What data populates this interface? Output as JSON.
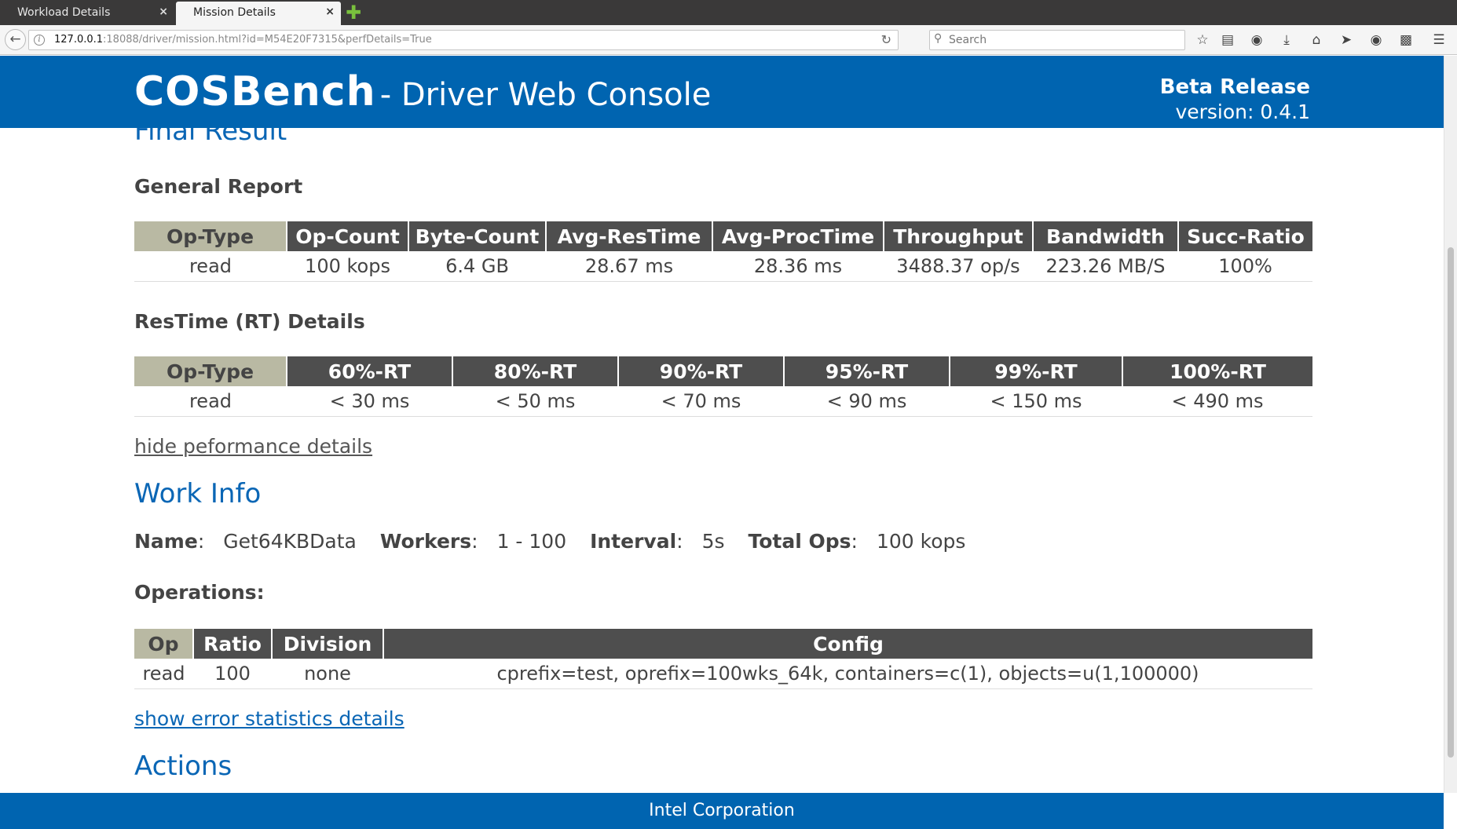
{
  "browser": {
    "tabs": [
      {
        "title": "Workload Details",
        "close": "×"
      },
      {
        "title": "Mission Details",
        "close": "×"
      }
    ],
    "new_tab_glyph": "✚",
    "url_host": "127.0.0.1",
    "url_rest": ":18088/driver/mission.html?id=M54E20F7315&perfDetails=True",
    "search_placeholder": "Search"
  },
  "header": {
    "brand_main": "COSBench",
    "brand_sub": "- Driver Web Console",
    "release_title": "Beta Release",
    "release_version": "version: 0.4.1"
  },
  "final_result": {
    "title": "Final Result",
    "general_report": {
      "title": "General Report",
      "columns": [
        "Op-Type",
        "Op-Count",
        "Byte-Count",
        "Avg-ResTime",
        "Avg-ProcTime",
        "Throughput",
        "Bandwidth",
        "Succ-Ratio"
      ],
      "rows": [
        [
          "read",
          "100 kops",
          "6.4 GB",
          "28.67 ms",
          "28.36 ms",
          "3488.37 op/s",
          "223.26 MB/S",
          "100%"
        ]
      ]
    },
    "rt_details": {
      "title": "ResTime (RT) Details",
      "columns": [
        "Op-Type",
        "60%-RT",
        "80%-RT",
        "90%-RT",
        "95%-RT",
        "99%-RT",
        "100%-RT"
      ],
      "rows": [
        [
          "read",
          "< 30 ms",
          "< 50 ms",
          "< 70 ms",
          "< 90 ms",
          "< 150 ms",
          "< 490 ms"
        ]
      ]
    },
    "hide_perf_link": "hide peformance details"
  },
  "work_info": {
    "title": "Work Info",
    "name_label": "Name",
    "name_value": "Get64KBData",
    "workers_label": "Workers",
    "workers_value": "1 - 100",
    "interval_label": "Interval",
    "interval_value": "5s",
    "total_ops_label": "Total Ops",
    "total_ops_value": "100 kops",
    "operations_title": "Operations:",
    "ops_columns": [
      "Op",
      "Ratio",
      "Division",
      "Config"
    ],
    "ops_rows": [
      [
        "read",
        "100",
        "none",
        "cprefix=test, oprefix=100wks_64k, containers=c(1), objects=u(1,100000)"
      ]
    ],
    "show_error_link": "show error statistics details"
  },
  "actions": {
    "title": "Actions"
  },
  "footer": {
    "text": "Intel Corporation"
  },
  "colors": {
    "header_blue": "#0064b0",
    "link_blue": "#0a66b5",
    "table_header": "#4e4e4e",
    "first_col_header": "#b9b9a3"
  }
}
